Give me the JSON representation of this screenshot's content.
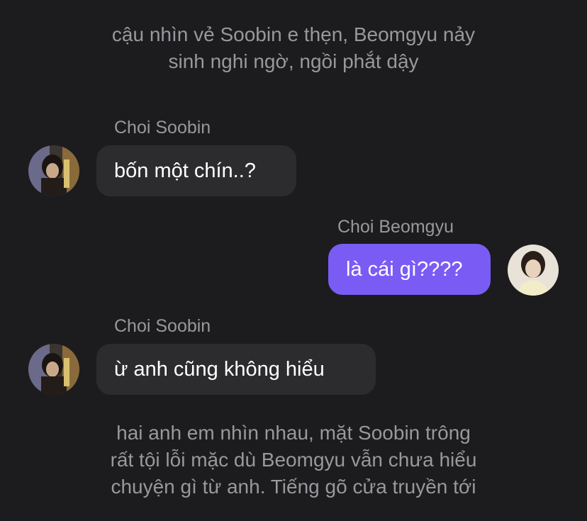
{
  "narration_top": {
    "line1": "cậu nhìn vẻ Soobin e thẹn, Beomgyu nảy",
    "line2": "sinh nghi ngờ, ngồi phắt dậy"
  },
  "messages": [
    {
      "sender": "Choi Soobin",
      "text": "bốn một chín..?"
    },
    {
      "sender": "Choi Beomgyu",
      "text": "là cái gì????"
    },
    {
      "sender": "Choi Soobin",
      "text": "ừ anh cũng không hiểu"
    }
  ],
  "narration_bottom": {
    "line1": "hai anh em nhìn nhau, mặt Soobin trông",
    "line2": "rất tội lỗi mặc dù Beomgyu vẫn chưa hiểu",
    "line3": "chuyện gì từ anh. Tiếng gõ cửa truyền tới"
  },
  "colors": {
    "background": "#1c1c1e",
    "incoming_bubble": "#2c2c2e",
    "outgoing_bubble": "#7a5cf5",
    "secondary_text": "#98989d"
  }
}
